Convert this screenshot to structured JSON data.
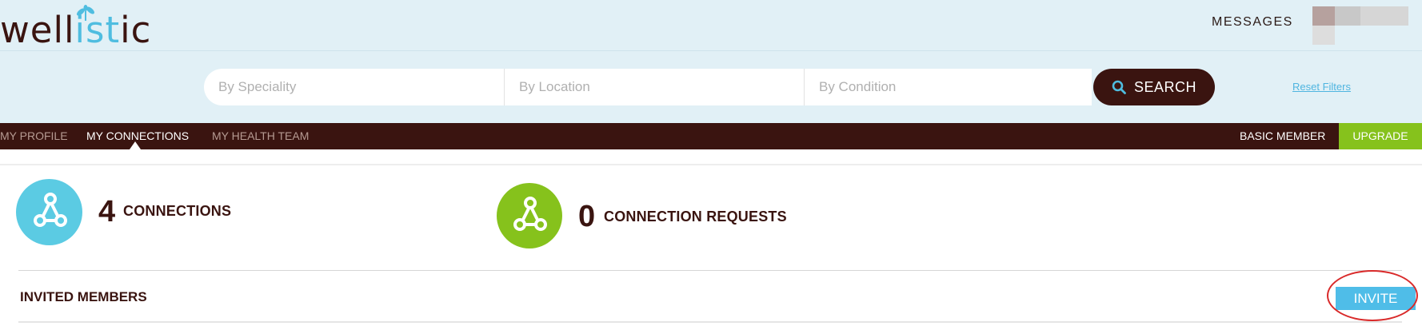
{
  "header": {
    "logo": {
      "part1": "well",
      "part2": "ist",
      "part3": "ic"
    },
    "messages_label": "MESSAGES"
  },
  "search": {
    "speciality_placeholder": "By Speciality",
    "location_placeholder": "By Location",
    "condition_placeholder": "By Condition",
    "search_label": "SEARCH",
    "reset_label": "Reset Filters"
  },
  "nav": {
    "items": [
      {
        "label": "MY PROFILE"
      },
      {
        "label": "MY CONNECTIONS"
      },
      {
        "label": "MY HEALTH TEAM"
      }
    ],
    "member_label": "BASIC MEMBER",
    "upgrade_label": "UPGRADE"
  },
  "stats": {
    "connections": {
      "count": "4",
      "label": "CONNECTIONS"
    },
    "requests": {
      "count": "0",
      "label": "CONNECTION REQUESTS"
    }
  },
  "invited": {
    "title": "INVITED MEMBERS",
    "invite_label": "INVITE"
  },
  "colors": {
    "brand_dark": "#3a1410",
    "brand_blue": "#5bcbe3",
    "brand_green": "#86c21c",
    "header_bg": "#e1f0f6",
    "highlight_ring": "#d92a2a"
  }
}
